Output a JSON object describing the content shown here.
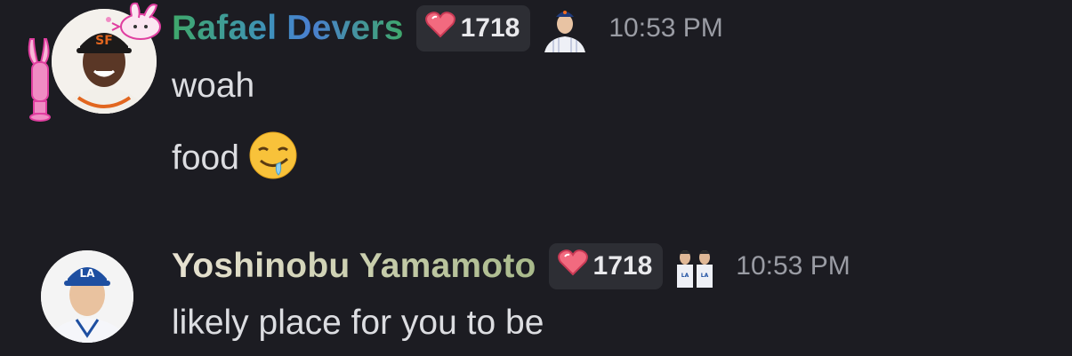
{
  "messages": [
    {
      "username": "Rafael Devers",
      "badge_count": "1718",
      "timestamp": "10:53 PM",
      "lines": [
        "woah",
        "food"
      ],
      "line_emoji": "drooling-face-icon",
      "name_color": "#3f8fc0"
    },
    {
      "username": "Yoshinobu Yamamoto",
      "badge_count": "1718",
      "timestamp": "10:53 PM",
      "lines": [
        "likely place for you to be"
      ],
      "name_color": "#cfd2b4"
    }
  ],
  "colors": {
    "background": "#1c1c22",
    "badge_bg": "#2d2e34",
    "heart": "#f26a7f",
    "timestamp": "#9a9ca4"
  },
  "icons": {
    "badge": "heart-icon",
    "avatar_decoration": "bunny-icon",
    "tag_1": "player-tag-icon",
    "tag_2": "duo-player-tag-icon"
  }
}
